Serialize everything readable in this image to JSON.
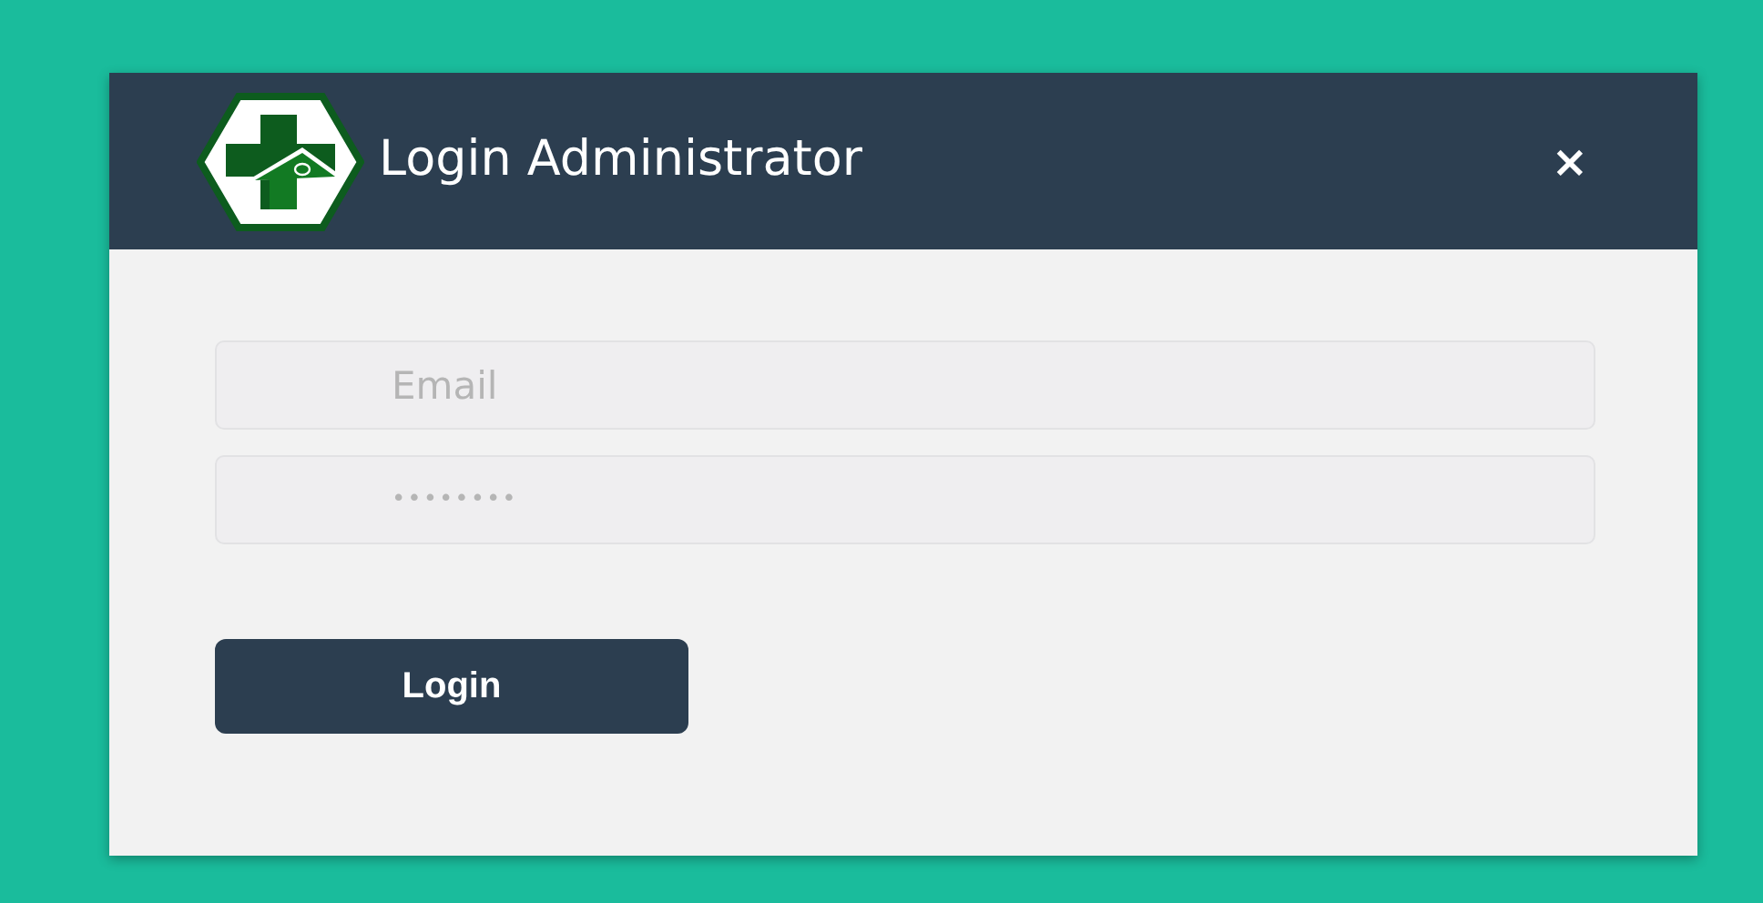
{
  "modal": {
    "title": "Login Administrator",
    "close": "×"
  },
  "fields": [
    {
      "placeholder": "Email",
      "kind": "email"
    },
    {
      "placeholder": "••••••••",
      "kind": "password"
    }
  ],
  "buttons": [
    "Login"
  ]
}
